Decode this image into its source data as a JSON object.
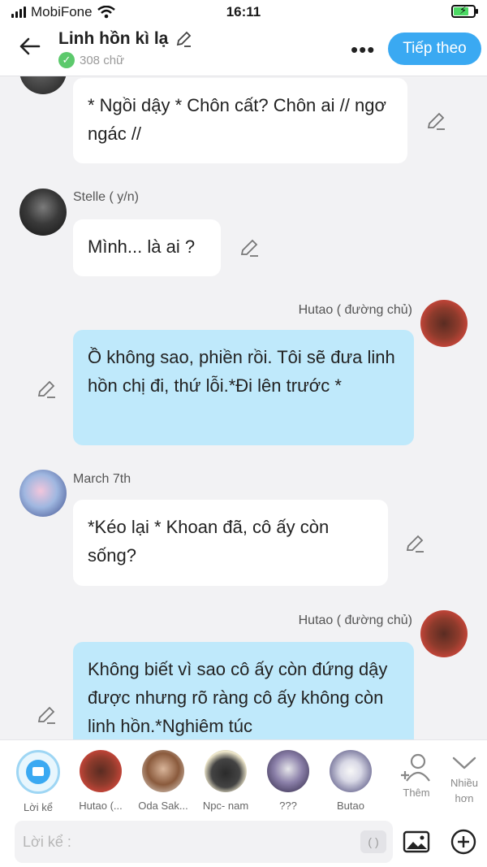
{
  "status_bar": {
    "carrier": "MobiFone",
    "time": "16:11"
  },
  "header": {
    "title": "Linh hồn kì lạ",
    "word_count": "308 chữ",
    "next_button": "Tiếp theo"
  },
  "messages": [
    {
      "text": "* Ngồi dậy * Chôn cất? Chôn ai // ngơ ngác //"
    },
    {
      "sender": "Stelle ( y/n)",
      "text": "Mình... là ai ?"
    },
    {
      "sender": "Hutao ( đường chủ)",
      "text": "Ồ không sao, phiền rồi. Tôi sẽ đưa linh hồn chị đi, thứ lỗi.*Đi lên trước *"
    },
    {
      "sender": "March 7th",
      "text": "*Kéo lại * Khoan đã, cô ấy còn sống?"
    },
    {
      "sender": "Hutao ( đường chủ)",
      "text": "Không biết vì sao cô ấy còn đứng dậy được nhưng rõ ràng cô ấy không còn linh hồn.*Nghiêm túc"
    }
  ],
  "characters": [
    {
      "label": "Lời kể"
    },
    {
      "label": "Hutao (..."
    },
    {
      "label": "Oda Sak..."
    },
    {
      "label": "Npc- nam"
    },
    {
      "label": "???"
    },
    {
      "label": "Butao"
    }
  ],
  "tools": {
    "add": "Thêm",
    "more_1": "Nhiều",
    "more_2": "hơn"
  },
  "input": {
    "placeholder": "Lời kể :",
    "paren": "( )"
  }
}
